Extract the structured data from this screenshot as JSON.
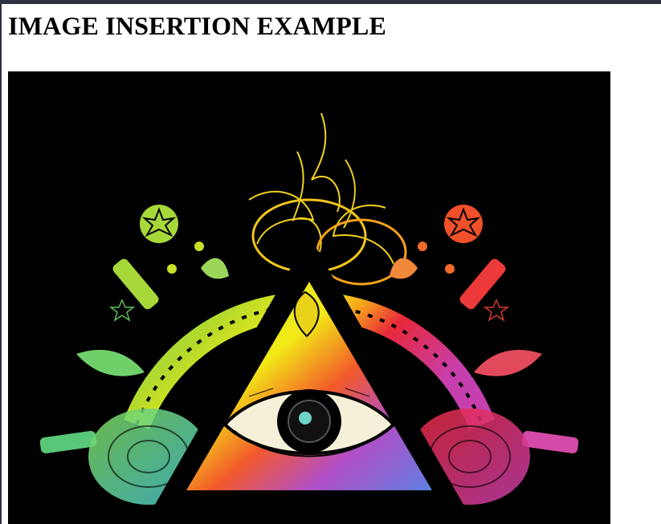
{
  "page": {
    "heading": "IMAGE INSERTION EXAMPLE"
  },
  "image": {
    "subject": "all-seeing-eye-triangle-illustration",
    "background_color": "#000000",
    "gradient_colors": [
      "#f2ea16",
      "#f6a21c",
      "#e8283a",
      "#c63fae",
      "#4f7fd6",
      "#47c9d6",
      "#7ed957",
      "#b5d92b"
    ]
  }
}
